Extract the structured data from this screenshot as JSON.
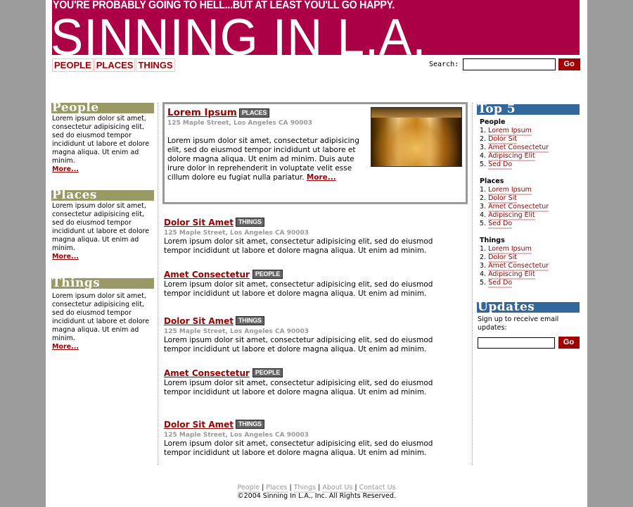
{
  "header": {
    "tagline": "YOU'RE PROBABLY GOING TO HELL...BUT AT LEAST YOU'LL GO HAPPY.",
    "logo": "SINNING IN L.A.",
    "brand_color": "#ab0045",
    "nav": [
      "PEOPLE",
      "PLACES",
      "THINGS"
    ],
    "search": {
      "label": "Search:",
      "value": "",
      "button": "Go"
    }
  },
  "left": {
    "sections": [
      {
        "title": "People",
        "text": "Lorem ipsum dolor sit amet, consectetur adipisicing elit, sed do eiusmod tempor incididunt ut labore et dolore magna aliqua. Ut enim ad minim.",
        "more": "More..."
      },
      {
        "title": "Places",
        "text": "Lorem ipsum dolor sit amet, consectetur adipisicing elit, sed do eiusmod tempor incididunt ut labore et dolore magna aliqua. Ut enim ad minim.",
        "more": "More..."
      },
      {
        "title": "Things",
        "text": "Lorem ipsum dolor sit amet, consectetur adipisicing elit, sed do eiusmod tempor incididunt ut labore et dolore magna aliqua. Ut enim ad minim.",
        "more": "More..."
      }
    ]
  },
  "feature": {
    "title": "Lorem Ipsum",
    "badge": "PLACES",
    "address": "125 Maple Street, Los Angeles CA 90003",
    "body": "Lorem ipsum dolor sit amet, consectetur adipisicing elit, sed do eiusmod tempor incididunt ut labore et dolore magna aliqua. Ut enim ad minim. Duis aute irure dolor in reprehenderit in voluptate velit esse cillum dolore eu fugiat nulla pariatur.",
    "more": "More...",
    "image": "restaurant-storefront-photo"
  },
  "articles": [
    {
      "title": "Dolor Sit Amet",
      "badge": "THINGS",
      "address": "125 Maple Street, Los Angeles CA 90003",
      "body": "Lorem ipsum dolor sit amet, consectetur adipisicing elit, sed do eiusmod tempor incididunt ut labore et dolore magna aliqua. Ut enim ad minim."
    },
    {
      "title": "Amet Consectetur",
      "badge": "PEOPLE",
      "address": "",
      "body": "Lorem ipsum dolor sit amet, consectetur adipisicing elit, sed do eiusmod tempor incididunt ut labore et dolore magna aliqua. Ut enim ad minim."
    },
    {
      "title": "Dolor Sit Amet",
      "badge": "THINGS",
      "address": "125 Maple Street, Los Angeles CA 90003",
      "body": "Lorem ipsum dolor sit amet, consectetur adipisicing elit, sed do eiusmod tempor incididunt ut labore et dolore magna aliqua. Ut enim ad minim."
    },
    {
      "title": "Amet Consectetur",
      "badge": "PEOPLE",
      "address": "",
      "body": "Lorem ipsum dolor sit amet, consectetur adipisicing elit, sed do eiusmod tempor incididunt ut labore et dolore magna aliqua. Ut enim ad minim."
    },
    {
      "title": "Dolor Sit Amet",
      "badge": "THINGS",
      "address": "125 Maple Street, Los Angeles CA 90003",
      "body": "Lorem ipsum dolor sit amet, consectetur adipisicing elit, sed do eiusmod tempor incididunt ut labore et dolore magna aliqua. Ut enim ad minim."
    }
  ],
  "top5": {
    "title": "Top 5",
    "groups": [
      {
        "name": "People",
        "items": [
          "Lorem Ipsum",
          "Dolor Sit",
          "Amet Consectetur",
          "Adipiscing Elit",
          "Sed Do"
        ]
      },
      {
        "name": "Places",
        "items": [
          "Lorem Ipsum",
          "Dolor Sit",
          "Amet Consectetur",
          "Adipiscing Elit",
          "Sed Do"
        ]
      },
      {
        "name": "Things",
        "items": [
          "Lorem Ipsum",
          "Dolor Sit",
          "Amet Consectetur",
          "Adipiscing Elit",
          "Sed Do"
        ]
      }
    ]
  },
  "updates": {
    "title": "Updates",
    "text": "Sign up to receive email updates:",
    "email_value": "",
    "button": "Go"
  },
  "footer": {
    "links": [
      "People",
      "Places",
      "Things",
      "About Us",
      "Contact Us"
    ],
    "copyright": "©2004 Sinning In L.A., Inc. All Rights Reserved."
  }
}
